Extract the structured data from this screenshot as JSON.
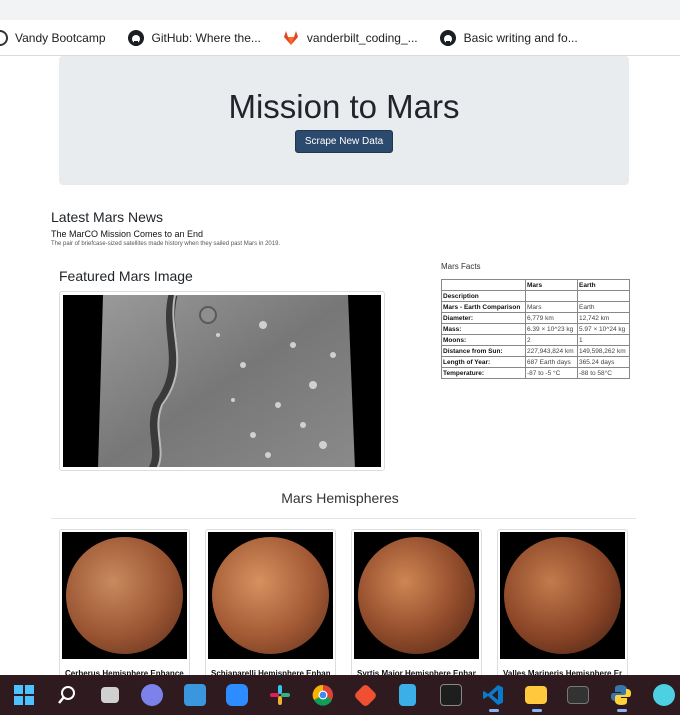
{
  "bookmarks": [
    {
      "label": "Vandy Bootcamp",
      "icon": "bootcamp-icon"
    },
    {
      "label": "GitHub: Where the...",
      "icon": "github-icon"
    },
    {
      "label": "vanderbilt_coding_...",
      "icon": "gitlab-icon"
    },
    {
      "label": "Basic writing and fo...",
      "icon": "github-icon"
    }
  ],
  "header": {
    "title": "Mission to Mars",
    "button_label": "Scrape New Data"
  },
  "news": {
    "section_title": "Latest Mars News",
    "headline": "The MarCO Mission Comes to an End",
    "teaser": "The pair of briefcase-sized satellites made history when they sailed past Mars in 2019."
  },
  "featured": {
    "title": "Featured Mars Image"
  },
  "facts": {
    "title": "Mars Facts",
    "columns": [
      "",
      "Mars",
      "Earth"
    ],
    "rows": [
      [
        "Description",
        "",
        ""
      ],
      [
        "Mars - Earth Comparison",
        "Mars",
        "Earth"
      ],
      [
        "Diameter:",
        "6,779 km",
        "12,742 km"
      ],
      [
        "Mass:",
        "6.39 × 10^23 kg",
        "5.97 × 10^24 kg"
      ],
      [
        "Moons:",
        "2",
        "1"
      ],
      [
        "Distance from Sun:",
        "227,943,824 km",
        "149,598,262 km"
      ],
      [
        "Length of Year:",
        "687 Earth days",
        "365.24 days"
      ],
      [
        "Temperature:",
        "-87 to -5 °C",
        "-88 to 58°C"
      ]
    ]
  },
  "hemispheres": {
    "title": "Mars Hemispheres",
    "items": [
      {
        "caption": "Cerberus Hemisphere Enhanced",
        "colors": [
          "#c98a5e",
          "#9a5533",
          "#5a2c1a"
        ]
      },
      {
        "caption": "Schiaparelli Hemisphere Enhanced",
        "colors": [
          "#d6915f",
          "#a35a35",
          "#5e2e1b"
        ]
      },
      {
        "caption": "Syrtis Major Hemisphere Enhanced",
        "colors": [
          "#cf8553",
          "#8f4a2a",
          "#4a2416"
        ]
      },
      {
        "caption": "Valles Marineris Hemisphere Enhanced",
        "colors": [
          "#c27b4c",
          "#8a4527",
          "#3f1f13"
        ]
      }
    ]
  },
  "taskbar": {
    "apps": [
      "start-icon",
      "search-icon",
      "task-view-icon",
      "teams-chat-icon",
      "calendar-icon",
      "zoom-icon",
      "slack-icon",
      "chrome-icon",
      "git-icon",
      "notepad-icon",
      "terminal-icon",
      "vscode-icon",
      "file-explorer-icon",
      "cmd-icon",
      "python-icon",
      "app-icon"
    ]
  }
}
